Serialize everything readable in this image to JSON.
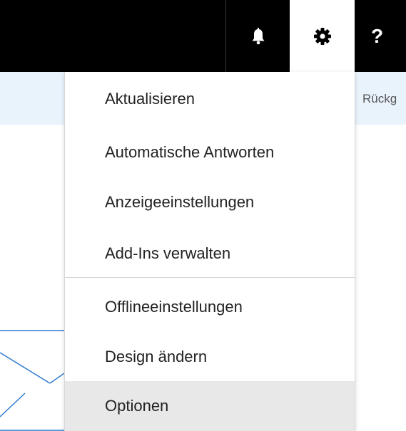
{
  "topbar": {
    "icons": [
      "bell-icon",
      "gear-icon",
      "help-icon"
    ],
    "help_label": "?"
  },
  "subbar": {
    "back_label": "Rückg"
  },
  "menu": {
    "items": [
      {
        "label": "Aktualisieren"
      },
      {
        "label": "Automatische Antworten"
      },
      {
        "label": "Anzeigeeinstellungen"
      },
      {
        "label": "Add-Ins verwalten"
      },
      {
        "label": "Offlineeinstellungen"
      },
      {
        "label": "Design ändern"
      },
      {
        "label": "Optionen",
        "highlighted": true
      }
    ]
  },
  "colors": {
    "topbar_bg": "#000000",
    "subbar_bg": "#e9f3fc",
    "accent_blue": "#2e7bd0",
    "highlight_bg": "#e8e8e8"
  }
}
